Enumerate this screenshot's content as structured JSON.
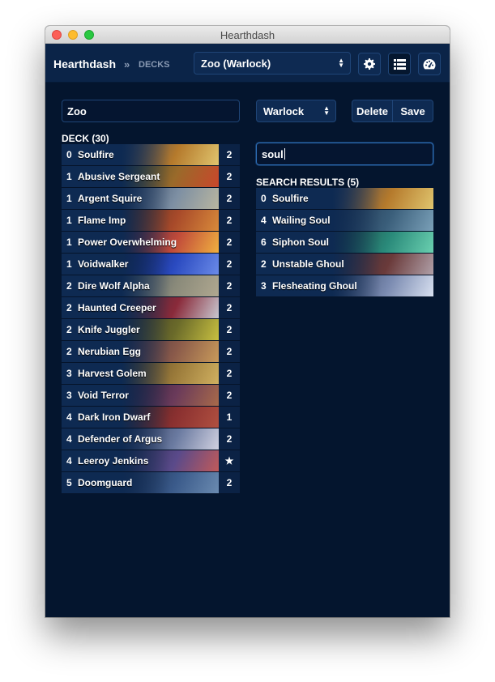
{
  "window": {
    "title": "Hearthdash"
  },
  "navbar": {
    "brand": "Hearthdash",
    "separator": "»",
    "crumb": "DECKS",
    "deck_select": {
      "value": "Zoo (Warlock)"
    },
    "buttons": [
      {
        "icon": "gear-icon"
      },
      {
        "icon": "list-icon"
      },
      {
        "icon": "dashboard-icon"
      }
    ]
  },
  "deck": {
    "name_value": "Zoo",
    "title": "DECK (30)",
    "cards": [
      {
        "cost": "0",
        "name": "Soulfire",
        "count": "2",
        "art": [
          "#2a3d5e",
          "#b57a2c",
          "#e0c56e"
        ]
      },
      {
        "cost": "1",
        "name": "Abusive Sergeant",
        "count": "2",
        "art": [
          "#3a4a2e",
          "#9a6a2a",
          "#c9472b"
        ]
      },
      {
        "cost": "1",
        "name": "Argent Squire",
        "count": "2",
        "art": [
          "#2c3e5c",
          "#7d8fa3",
          "#b9b6a0"
        ]
      },
      {
        "cost": "1",
        "name": "Flame Imp",
        "count": "2",
        "art": [
          "#4a2a1e",
          "#a84a2a",
          "#d98a3a"
        ]
      },
      {
        "cost": "1",
        "name": "Power Overwhelming",
        "count": "2",
        "art": [
          "#3a2040",
          "#c04a3a",
          "#f0b040"
        ]
      },
      {
        "cost": "1",
        "name": "Voidwalker",
        "count": "2",
        "art": [
          "#101c5a",
          "#2a4ac0",
          "#6a8ae8"
        ]
      },
      {
        "cost": "2",
        "name": "Dire Wolf Alpha",
        "count": "2",
        "art": [
          "#3a4a5e",
          "#8a8a7a",
          "#b0a890"
        ]
      },
      {
        "cost": "2",
        "name": "Haunted Creeper",
        "count": "2",
        "art": [
          "#2a2a3a",
          "#8a2a3a",
          "#c8c8d0"
        ]
      },
      {
        "cost": "2",
        "name": "Knife Juggler",
        "count": "2",
        "art": [
          "#3a3020",
          "#6a6a2a",
          "#c8c040"
        ]
      },
      {
        "cost": "2",
        "name": "Nerubian Egg",
        "count": "2",
        "art": [
          "#3a2a3e",
          "#8a5a4a",
          "#c89a5a"
        ]
      },
      {
        "cost": "3",
        "name": "Harvest Golem",
        "count": "2",
        "art": [
          "#4a3a20",
          "#9a7a3a",
          "#d0b060"
        ]
      },
      {
        "cost": "3",
        "name": "Void Terror",
        "count": "2",
        "art": [
          "#2a1a30",
          "#6a3a5a",
          "#a86a4a"
        ]
      },
      {
        "cost": "4",
        "name": "Dark Iron Dwarf",
        "count": "1",
        "art": [
          "#3a2020",
          "#8a3030",
          "#b05040"
        ]
      },
      {
        "cost": "4",
        "name": "Defender of Argus",
        "count": "2",
        "art": [
          "#2a3050",
          "#6a7aa0",
          "#d0d0e0"
        ]
      },
      {
        "cost": "4",
        "name": "Leeroy Jenkins",
        "count": "★",
        "art": [
          "#2a2a4a",
          "#5a4a8a",
          "#c05a5a"
        ]
      },
      {
        "cost": "5",
        "name": "Doomguard",
        "count": "2",
        "art": [
          "#1a2a4a",
          "#3a5a8a",
          "#6a8ab0"
        ]
      }
    ]
  },
  "class_select": {
    "value": "Warlock"
  },
  "actions": {
    "delete_label": "Delete",
    "save_label": "Save"
  },
  "search": {
    "value": "soul",
    "title": "SEARCH RESULTS (5)",
    "results": [
      {
        "cost": "0",
        "name": "Soulfire",
        "art": [
          "#2a3d5e",
          "#b57a2c",
          "#e0c56e"
        ]
      },
      {
        "cost": "4",
        "name": "Wailing Soul",
        "art": [
          "#1a2e4a",
          "#3a5e7a",
          "#7aa0b8"
        ]
      },
      {
        "cost": "6",
        "name": "Siphon Soul",
        "art": [
          "#1a3a3a",
          "#2a8a7a",
          "#6ad0b0"
        ]
      },
      {
        "cost": "2",
        "name": "Unstable Ghoul",
        "art": [
          "#2a2a3a",
          "#6a3a3a",
          "#b0a0a8"
        ]
      },
      {
        "cost": "3",
        "name": "Flesheating Ghoul",
        "art": [
          "#2a3a5a",
          "#7a8ab0",
          "#d8e0f0"
        ]
      }
    ]
  }
}
